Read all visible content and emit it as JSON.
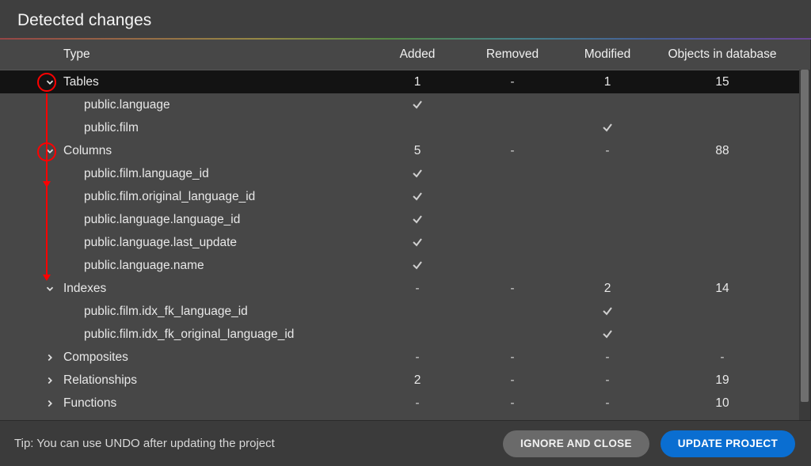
{
  "title": "Detected changes",
  "columns": {
    "type": "Type",
    "added": "Added",
    "removed": "Removed",
    "modified": "Modified",
    "objects": "Objects in database"
  },
  "sections": [
    {
      "name": "Tables",
      "expanded": true,
      "highlight": true,
      "added": "1",
      "removed": "-",
      "modified": "1",
      "objects": "15",
      "children": [
        {
          "name": "public.language",
          "added": "check",
          "removed": "",
          "modified": "",
          "objects": ""
        },
        {
          "name": "public.film",
          "added": "",
          "removed": "",
          "modified": "check",
          "objects": ""
        }
      ]
    },
    {
      "name": "Columns",
      "expanded": true,
      "highlight": true,
      "added": "5",
      "removed": "-",
      "modified": "-",
      "objects": "88",
      "children": [
        {
          "name": "public.film.language_id",
          "added": "check",
          "removed": "",
          "modified": "",
          "objects": ""
        },
        {
          "name": "public.film.original_language_id",
          "added": "check",
          "removed": "",
          "modified": "",
          "objects": ""
        },
        {
          "name": "public.language.language_id",
          "added": "check",
          "removed": "",
          "modified": "",
          "objects": ""
        },
        {
          "name": "public.language.last_update",
          "added": "check",
          "removed": "",
          "modified": "",
          "objects": ""
        },
        {
          "name": "public.language.name",
          "added": "check",
          "removed": "",
          "modified": "",
          "objects": ""
        }
      ]
    },
    {
      "name": "Indexes",
      "expanded": true,
      "highlight": false,
      "added": "-",
      "removed": "-",
      "modified": "2",
      "objects": "14",
      "children": [
        {
          "name": "public.film.idx_fk_language_id",
          "added": "",
          "removed": "",
          "modified": "check",
          "objects": ""
        },
        {
          "name": "public.film.idx_fk_original_language_id",
          "added": "",
          "removed": "",
          "modified": "check",
          "objects": ""
        }
      ]
    },
    {
      "name": "Composites",
      "expanded": false,
      "highlight": false,
      "added": "-",
      "removed": "-",
      "modified": "-",
      "objects": "-",
      "children": []
    },
    {
      "name": "Relationships",
      "expanded": false,
      "highlight": false,
      "added": "2",
      "removed": "-",
      "modified": "-",
      "objects": "19",
      "children": []
    },
    {
      "name": "Functions",
      "expanded": false,
      "highlight": false,
      "added": "-",
      "removed": "-",
      "modified": "-",
      "objects": "10",
      "children": []
    }
  ],
  "footer": {
    "tip": "Tip: You can use UNDO after updating the project",
    "ignore": "IGNORE AND CLOSE",
    "update": "UPDATE PROJECT"
  }
}
